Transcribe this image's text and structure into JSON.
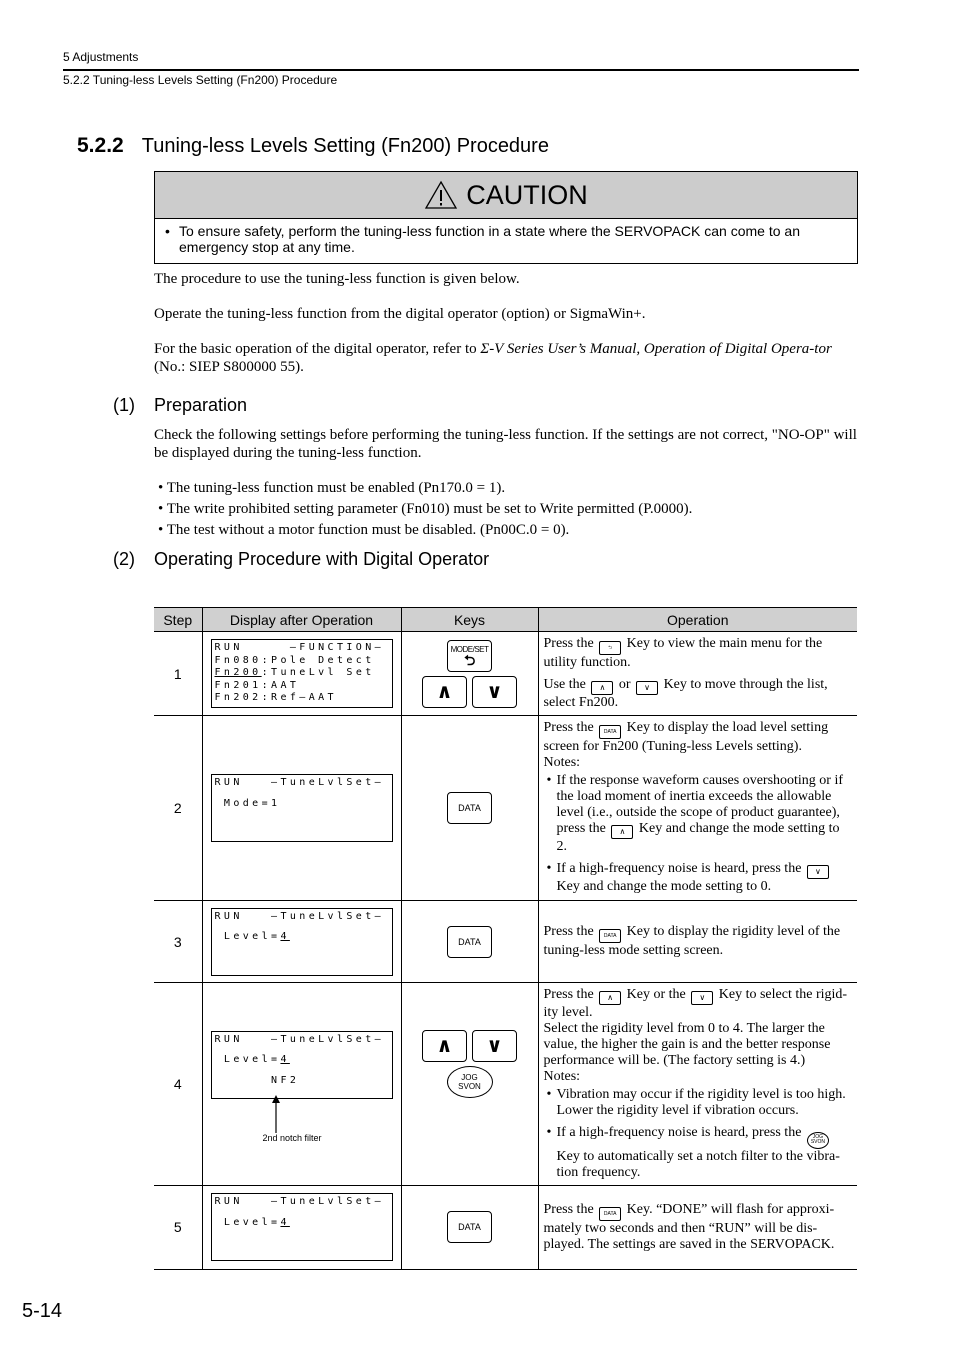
{
  "header": {
    "chapter": "5  Adjustments",
    "section": "5.2.2  Tuning-less Levels Setting (Fn200) Procedure"
  },
  "section": {
    "number": "5.2.2",
    "title": "Tuning-less Levels Setting (Fn200) Procedure"
  },
  "caution": {
    "icon": "warning-triangle-icon",
    "title": "CAUTION",
    "text": "To ensure safety, perform the tuning-less function in a state where the SERVOPACK can come to an emergency stop at any time."
  },
  "intro": {
    "p1": "The procedure to use the tuning-less function is given below.",
    "p2": "Operate the tuning-less function from the digital operator (option) or SigmaWin+.",
    "p3_before": "For the basic operation of the digital operator, refer to ",
    "p3_italic": "Σ-V Series User’s Manual, Operation of Digital Opera-tor",
    "p3_after": " (No.: SIEP S800000 55)."
  },
  "preparation": {
    "number": "(1)",
    "heading": "Preparation",
    "text": "Check the following settings before performing the tuning-less function. If the settings are not correct, \"NO-OP\" will be displayed during the tuning-less function.",
    "bullets": [
      "The tuning-less function must be enabled (Pn170.0 = 1).",
      "The write prohibited setting parameter (Fn010) must be set to Write permitted (P.0000).",
      "The test without a motor function must be disabled. (Pn00C.0 = 0)."
    ]
  },
  "procedure": {
    "number": "(2)",
    "heading": "Operating Procedure with Digital Operator",
    "columns": [
      "Step",
      "Display after Operation",
      "Keys",
      "Operation"
    ],
    "keys": {
      "mode_set": "MODE/SET",
      "data": "DATA",
      "jog1": "JOG",
      "jog2": "SVON",
      "up": "∧",
      "down": "∨"
    },
    "steps": [
      {
        "step": "1",
        "display": [
          "RUN     —FUNCTION—",
          "Fn080:Pole Detect",
          "Fn200",
          ":TuneLvl Set",
          "Fn201:AAT",
          "Fn202:Ref—AAT"
        ],
        "op": {
          "a1": "Press the",
          "a2": "Key to view the main menu for the utility function.",
          "b1": "Use the",
          "b2": "or",
          "b3": "Key to move through the list, select Fn200."
        }
      },
      {
        "step": "2",
        "display": [
          "RUN   —TuneLvlSet—",
          " Mode=1"
        ],
        "op": {
          "a1": "Press the",
          "a2": "Key to display the load level setting screen for Fn200 (Tuning-less Levels setting).",
          "notes": "Notes:",
          "n1a": "If the response waveform causes overshooting or if the load moment of inertia exceeds the allowable level (i.e., outside the scope of product guarantee), press the",
          "n1b": "Key and change the mode setting to 2.",
          "n2a": "If a high-frequency noise is heard, press the",
          "n2b": "Key and change the mode setting to 0."
        }
      },
      {
        "step": "3",
        "display": [
          "RUN   —TuneLvlSet—",
          " Level=",
          "4"
        ],
        "op": {
          "a1": "Press the",
          "a2": "Key to display the rigidity level of the tuning-less mode setting screen."
        }
      },
      {
        "step": "4",
        "display": [
          "RUN   —TuneLvlSet—",
          " Level=",
          "4",
          "      NF2"
        ],
        "annotation": "2nd notch filter",
        "op": {
          "a1": "Press the",
          "a2": "Key or the",
          "a3": "Key to select the rigid-ity level.",
          "b": "Select the rigidity level from 0 to 4. The larger the value, the higher the gain is and the better response performance will be. (The factory setting is 4.)",
          "notes": "Notes:",
          "n1": "Vibration may occur if the rigidity level is too high. Lower the rigidity level if vibration occurs.",
          "n2a": "If a high-frequency noise is heard, press the",
          "n2b": "Key to automatically set a notch filter to the vibra-tion frequency."
        }
      },
      {
        "step": "5",
        "display": [
          "RUN   —TuneLvlSet—",
          " Level=",
          "4"
        ],
        "op": {
          "a1": "Press the",
          "a2": "Key. “DONE” will flash for approxi-mately two seconds and then “RUN” will be dis-played. The settings are saved in the SERVOPACK."
        }
      }
    ]
  },
  "footer": {
    "page": "5-14"
  }
}
